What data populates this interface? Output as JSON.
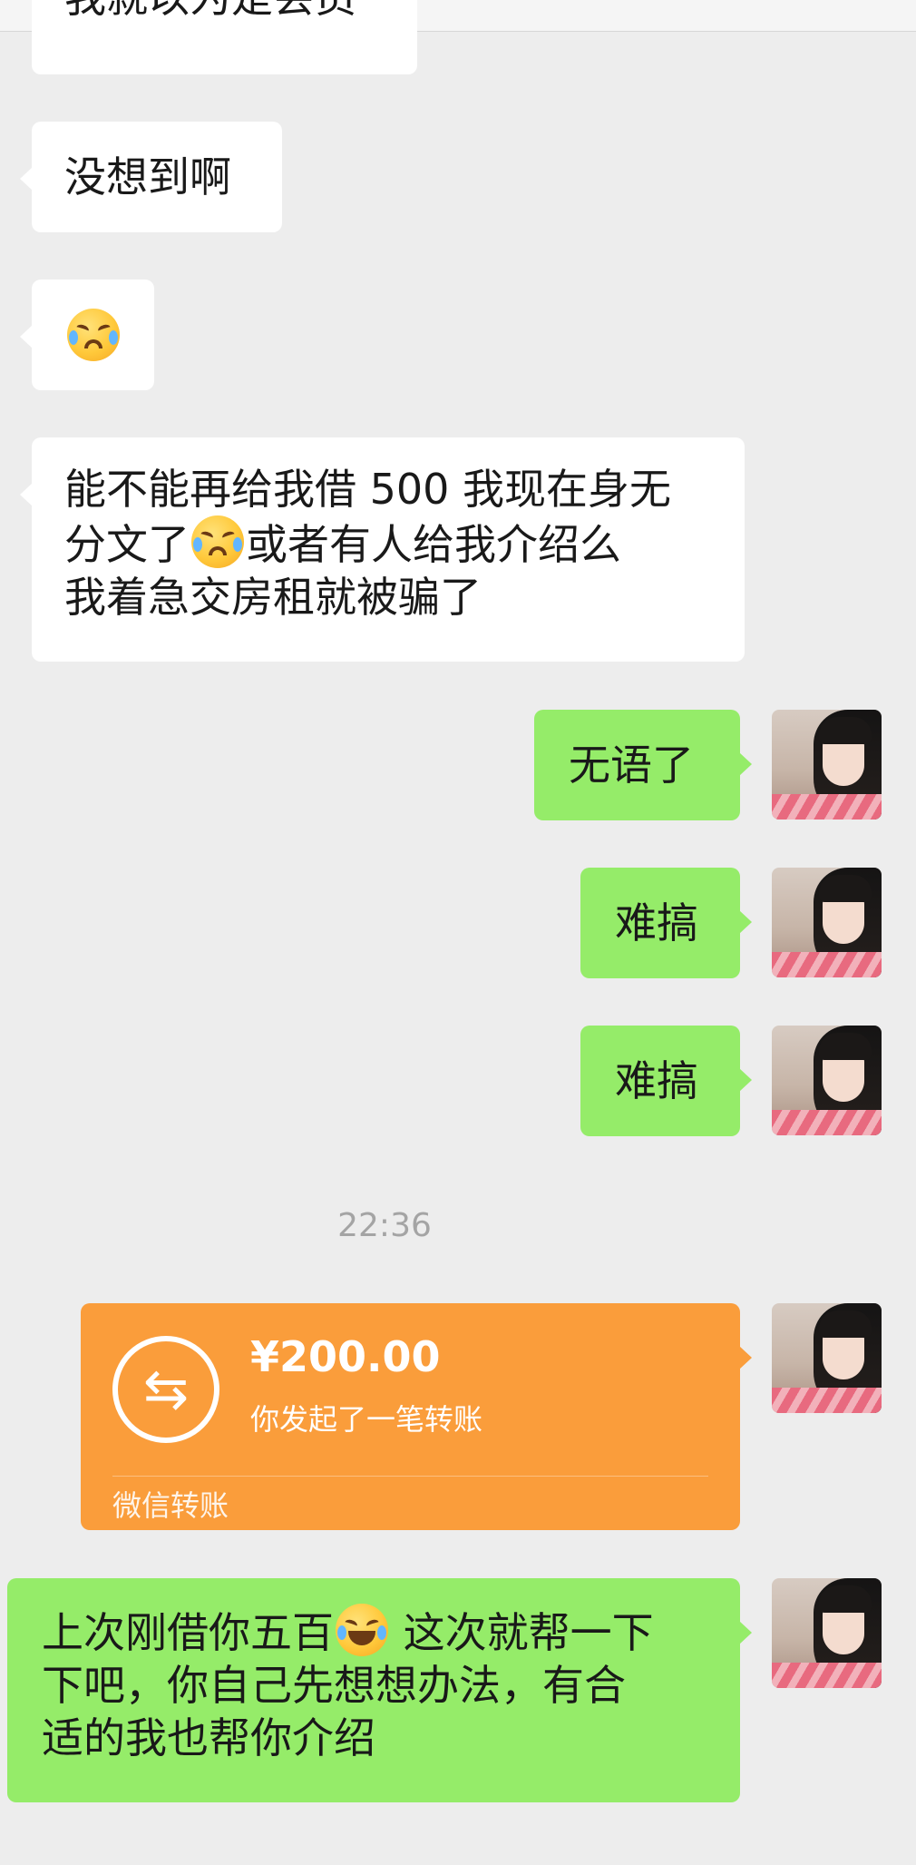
{
  "messages": [
    {
      "side": "in",
      "text": "我就以为是会员",
      "partial": true
    },
    {
      "side": "in",
      "text": "没想到啊"
    },
    {
      "side": "in",
      "emoji": "crying-face"
    },
    {
      "side": "in",
      "text_part1": "能不能再给我借 500 我现在身无\n分文了",
      "text_part2": "或者有人给我介绍么\n我着急交房租就被骗了"
    },
    {
      "side": "out",
      "text": "无语了"
    },
    {
      "side": "out",
      "text": "难搞"
    },
    {
      "side": "out",
      "text": "难搞"
    },
    {
      "side": "out",
      "text_part1": "上次刚借你五百",
      "text_part2": " 这次就帮一下\n下吧，你自己先想想办法，有合\n适的我也帮你介绍"
    }
  ],
  "timestamp": "22:36",
  "transfer": {
    "icon": "transfer-arrows-icon",
    "amount": "¥200.00",
    "description": "你发起了一笔转账",
    "footer": "微信转账"
  },
  "colors": {
    "background": "#ededed",
    "incoming_bubble": "#ffffff",
    "outgoing_bubble": "#95ec69",
    "transfer_card": "#fa9d3b",
    "timestamp": "#a4a4a4"
  }
}
